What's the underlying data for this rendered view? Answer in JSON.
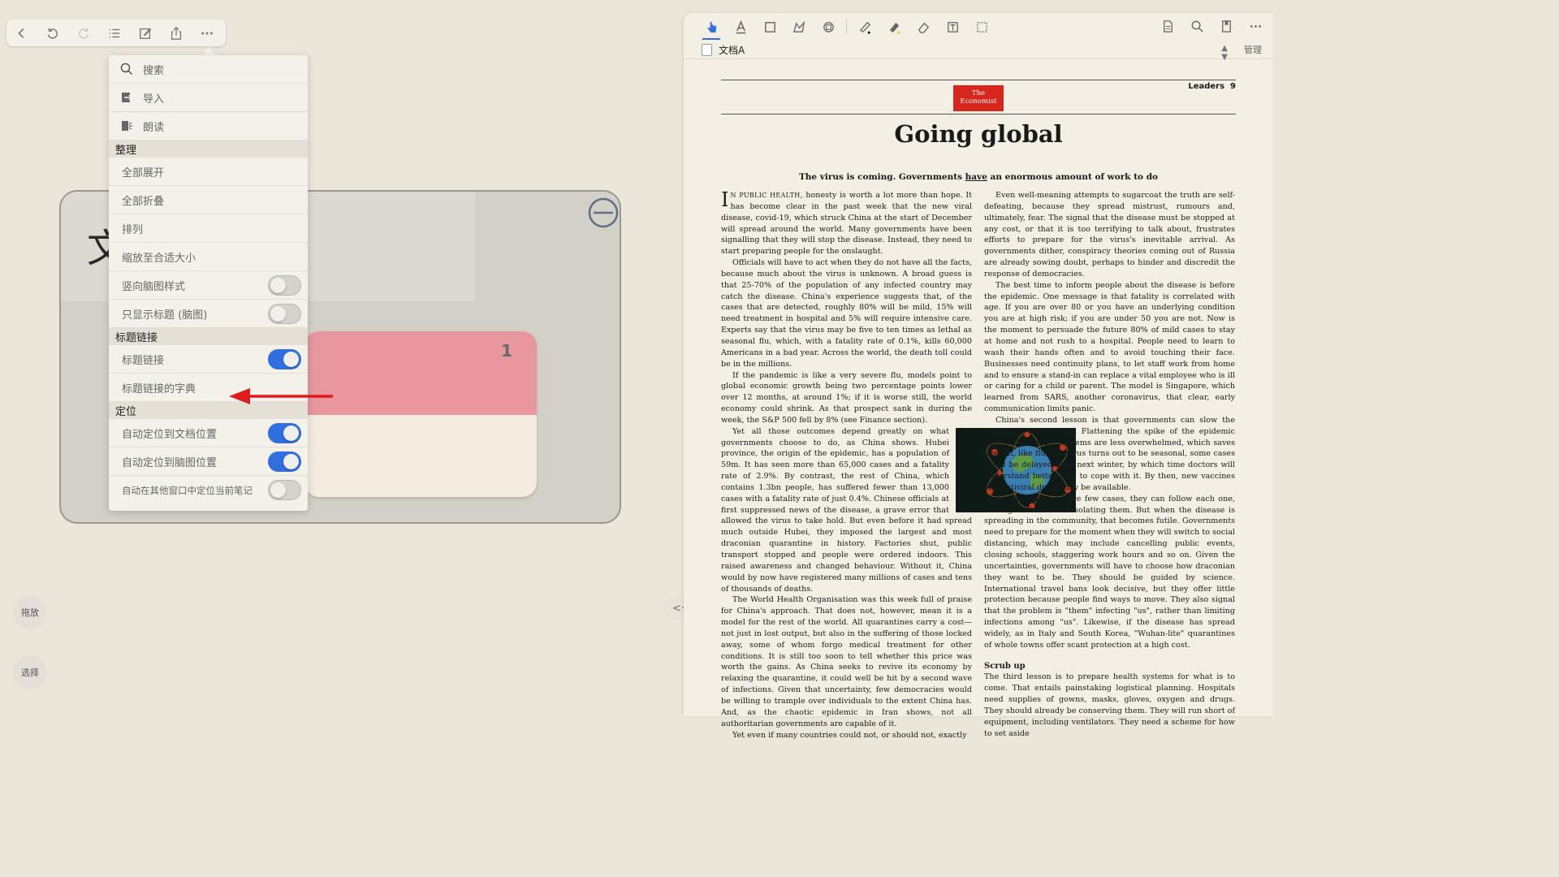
{
  "left_toolbar": {
    "buttons": [
      "back-icon",
      "undo-icon",
      "redo-icon",
      "outline-list-icon",
      "edit-icon",
      "share-icon",
      "more-icon"
    ]
  },
  "mind_map": {
    "root_char": "文",
    "node_number": "1"
  },
  "side_buttons": {
    "drag": "拖放",
    "select": "选择"
  },
  "menu": {
    "search": "搜索",
    "import": "导入",
    "read_aloud": "朗读",
    "section_organize": "整理",
    "expand_all": "全部展开",
    "collapse_all": "全部折叠",
    "arrange": "排列",
    "fit_size": "缩放至合适大小",
    "vertical_style": {
      "label": "竖向脑图样式",
      "on": false
    },
    "titles_only": {
      "label": "只显示标题 (脑图)",
      "on": false
    },
    "section_title_links": "标题链接",
    "title_link": {
      "label": "标题链接",
      "on": true
    },
    "title_link_dict": "标题链接的字典",
    "section_locate": "定位",
    "auto_doc": {
      "label": "自动定位到文档位置",
      "on": true
    },
    "auto_mindmap": {
      "label": "自动定位到脑图位置",
      "on": true
    },
    "auto_other_window": {
      "label": "自动在其他窗口中定位当前笔记",
      "on": false
    }
  },
  "pdf": {
    "tab_title": "文档A",
    "manage": "管理",
    "masthead_line1": "The",
    "masthead_line2": "Economist",
    "section": "Leaders",
    "page_number": "9",
    "headline": "Going global",
    "standfirst_a": "The virus is coming. Governments ",
    "standfirst_have": "have",
    "standfirst_b": " an enormous amount of work to do",
    "col1": {
      "dropcap": "I",
      "lead_caps": "N PUBLIC HEALTH",
      "p1": ", honesty is worth a lot more than hope. It has become clear in the past week that the new viral disease, covid-19, which struck China at the start of December will spread around the world. Many governments have been signalling that they will stop the disease. Instead, they need to start preparing people for the onslaught.",
      "p2": "Officials will have to act when they do not have all the facts, because much about the virus is unknown. A broad guess is that 25-70% of the population of any infected country may catch the disease. China's experience suggests that, of the cases that are detected, roughly 80% will be mild, 15% will need treatment in hospital and 5% will require intensive care. Experts say that the virus may be five to ten times as lethal as seasonal flu, which, with a fatality rate of 0.1%, kills 60,000 Americans in a bad year. Across the world, the death toll could be in the millions.",
      "p3": "If the pandemic is like a very severe flu, models point to global economic growth being two percentage points lower over 12 months, at around 1%; if it is worse still, the world economy could shrink. As that prospect sank in during the week, the S&P 500 fell by 8% (see Finance section).",
      "p4": "Yet all those outcomes depend greatly on what governments choose to do, as China shows. Hubei province, the origin of the epidemic, has a population of 59m. It has seen more than 65,000 cases and a fatality rate of 2.9%. By contrast, the rest of China, which contains 1.3bn people, has suffered fewer than 13,000 cases with a fatality rate of just 0.4%. Chinese officials at first suppressed news of the disease, a grave error that allowed the virus to take hold. But even before it had spread much outside Hubei, they imposed the largest and most draconian quarantine in history. Factories shut, public transport stopped and people were ordered indoors. This raised awareness and changed behaviour. Without it, China would by now have registered many millions of cases and tens of thousands of deaths.",
      "p5": "The World Health Organisation was this week full of praise for China's approach. That does not, however, mean it is a model for the rest of the world. All quarantines carry a cost—not just in lost output, but also in the suffering of those locked away, some of whom forgo medical treatment for other conditions. It is still too soon to tell whether this price was worth the gains. As China seeks to revive its economy by relaxing the quarantine, it could well be hit by a second wave of infections. Given that uncertainty, few democracies would be willing to trample over individuals to the extent China has. And, as the chaotic epidemic in Iran shows, not all authoritarian governments are capable of it.",
      "p6": "Yet even if many countries could not, or should not, exactly"
    },
    "col2": {
      "p1": "Even well-meaning attempts to sugarcoat the truth are self-defeating, because they spread mistrust, rumours and, ultimately, fear. The signal that the disease must be stopped at any cost, or that it is too terrifying to talk about, frustrates efforts to prepare for the virus's inevitable arrival. As governments dither, conspiracy theories coming out of Russia are already sowing doubt, perhaps to hinder and discredit the response of democracies.",
      "p2": "The best time to inform people about the disease is before the epidemic. One message is that fatality is correlated with age. If you are over 80 or you have an underlying condition you are at high risk; if you are under 50 you are not. Now is the moment to persuade the future 80% of mild cases to stay at home and not rush to a hospital. People need to learn to wash their hands often and to avoid touching their face. Businesses need continuity plans, to let staff work from home and to ensure a stand-in can replace a vital employee who is ill or caring for a child or parent. The model is Singapore, which learned from SARS, another coronavirus, that clear, early communication limits panic.",
      "p3": "China's second lesson is that governments can slow the spread of the disease. Flattening the spike of the epidemic means that health systems are less overwhelmed, which saves lives. If, like flu, the virus turns out to be seasonal, some cases could be delayed until next winter, by which time doctors will understand better how to cope with it. By then, new vaccines and antiviral drugs may be available.",
      "p4": "When countries have few cases, they can follow each one, tracing contacts and isolating them. But when the disease is spreading in the community, that becomes futile. Governments need to prepare for the moment when they will switch to social distancing, which may include cancelling public events, closing schools, staggering work hours and so on. Given the uncertainties, governments will have to choose how draconian they want to be. They should be guided by science. International travel bans look decisive, but they offer little protection because people find ways to move. They also signal that the problem is \"them\" infecting \"us\", rather than limiting infections among \"us\". Likewise, if the disease has spread widely, as in Italy and South Korea, \"Wuhan-lite\" quarantines of whole towns offer scant protection at a high cost.",
      "subhead": "Scrub up",
      "p5": "The third lesson is to prepare health systems for what is to come. That entails painstaking logistical planning. Hospitals need supplies of gowns, masks, gloves, oxygen and drugs. They should already be conserving them. They will run short of equipment, including ventilators. They need a scheme for how to set aside"
    }
  },
  "colors": {
    "background": "#ebe6da",
    "toggle_on": "#2f6fe0",
    "node_pink": "#e8979e",
    "arrow_red": "#e01b1b",
    "masthead_red": "#d9261c"
  }
}
